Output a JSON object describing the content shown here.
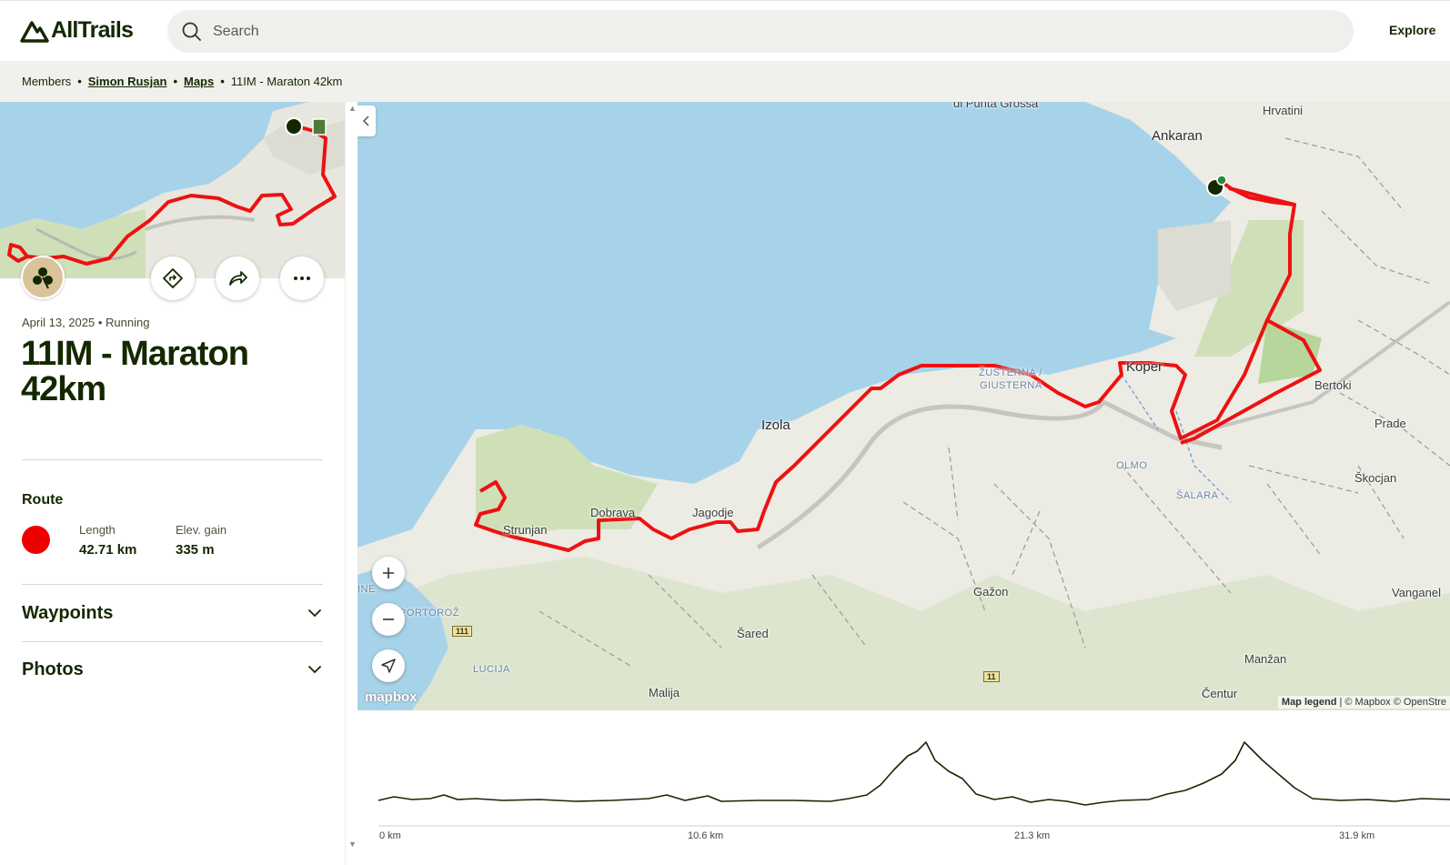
{
  "app": {
    "logo_text": "AllTrails",
    "search_placeholder": "Search",
    "nav_explore": "Explore"
  },
  "breadcrumb": {
    "items": [
      "Members",
      "Simon Rusjan",
      "Maps",
      "11IM - Maraton 42km"
    ]
  },
  "activity": {
    "date": "April 13, 2025",
    "type": "Running",
    "title": "11IM - Maraton 42km"
  },
  "route": {
    "heading": "Route",
    "color": "#ee0000",
    "length_label": "Length",
    "length_value": "42.71 km",
    "elev_label": "Elev. gain",
    "elev_value": "335 m"
  },
  "sections": {
    "waypoints": "Waypoints",
    "photos": "Photos"
  },
  "map": {
    "labels": {
      "punta": "di Punta Grossa",
      "hrvatini": "Hrvatini",
      "ankaran": "Ankaran",
      "koper": "Koper",
      "zusterna": "ŽUSTERNA /",
      "giusterna": "GIUSTERNA",
      "bertoki": "Bertoki",
      "prade": "Prade",
      "izola": "Izola",
      "olmo": "OLMO",
      "salara": "ŠALARA",
      "skocjan": "Škocjan",
      "strunjan": "Strunjan",
      "dobrava": "Dobrava",
      "jagodje": "Jagodje",
      "gazon": "Gažon",
      "sared": "Šared",
      "vanganel": "Vanganel",
      "manzan": "Manžan",
      "centur": "Čentur",
      "lucija": "LUCIJA",
      "malija": "Malija",
      "portoroz": "PORTOROŽ",
      "ine": "INE",
      "road_111": "111",
      "road_11": "11"
    },
    "attribution_legend": "Map legend",
    "attribution_text": "| © Mapbox © OpenStre",
    "mapbox_logo": "mapbox"
  },
  "elevation": {
    "x_ticks": [
      "0 km",
      "10.6 km",
      "21.3 km",
      "31.9 km"
    ]
  },
  "colors": {
    "brand_dark": "#142800",
    "route_red": "#ee0000",
    "water": "#a7d3ea",
    "land": "#ecebe4"
  }
}
